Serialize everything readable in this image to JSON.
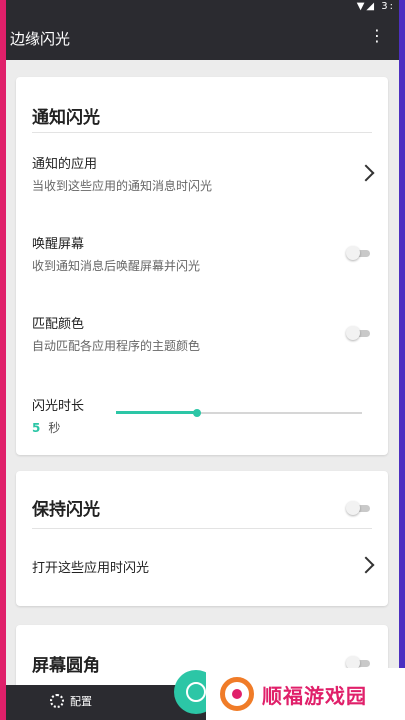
{
  "status_bar": {
    "icons": "▼◢ 3:"
  },
  "app_bar": {
    "title": "边缘闪光",
    "menu_icon": "more-vert-icon"
  },
  "notification_card": {
    "title": "通知闪光",
    "rows": [
      {
        "title": "通知的应用",
        "subtitle": "当收到这些应用的通知消息时闪光",
        "control": "chevron"
      },
      {
        "title": "唤醒屏幕",
        "subtitle": "收到通知消息后唤醒屏幕并闪光",
        "control": "toggle",
        "on": false
      },
      {
        "title": "匹配颜色",
        "subtitle": "自动匹配各应用程序的主题颜色",
        "control": "toggle",
        "on": false
      }
    ],
    "duration": {
      "label": "闪光时长",
      "value": "5",
      "unit": "秒",
      "fraction": 0.33
    }
  },
  "keep_card": {
    "title": "保持闪光",
    "toggle_on": false,
    "row": {
      "title": "打开这些应用时闪光"
    }
  },
  "corner_card": {
    "title": "屏幕圆角",
    "toggle_on": false
  },
  "bottom_bar": {
    "config_label": "配置"
  },
  "watermark": {
    "text": "顺福游戏园"
  },
  "colors": {
    "accent": "#2cc6a6",
    "background": "#ececec",
    "bar": "#2b2b30"
  }
}
